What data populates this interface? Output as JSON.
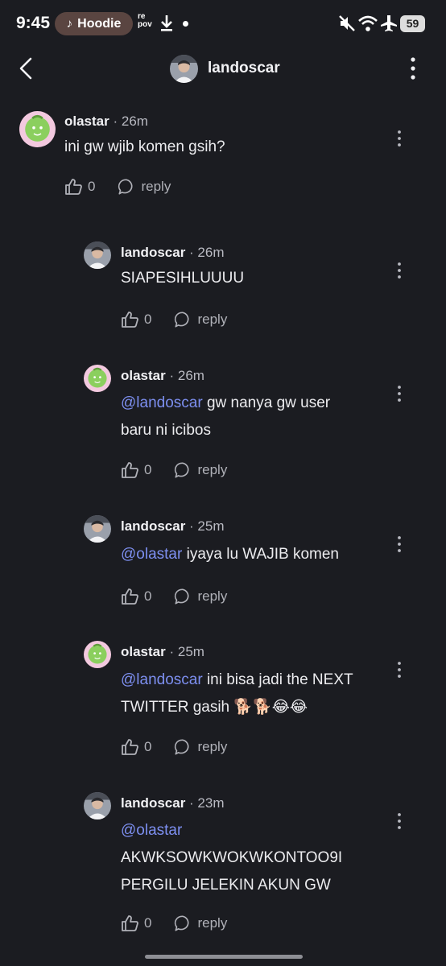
{
  "status_bar": {
    "time": "9:45",
    "music_label": "Hoodie",
    "app_tag_line1": "re",
    "app_tag_line2": "pov",
    "battery": "59",
    "icons": [
      "music-note-icon",
      "download-icon",
      "mute-icon",
      "wifi-icon",
      "airplane-icon",
      "battery-icon"
    ]
  },
  "header": {
    "title": "landoscar",
    "icons": [
      "back-icon",
      "more-vert-icon"
    ]
  },
  "colors": {
    "background": "#1b1c21",
    "mention": "#7d8ff0",
    "meta_text": "#b9bac2"
  },
  "comments": [
    {
      "author": "olastar",
      "time": "· 26m",
      "mention": "",
      "text": "ini gw wjib komen gsih?",
      "likes": "0",
      "reply_label": "reply"
    },
    {
      "author": "landoscar",
      "time": "· 26m",
      "mention": "",
      "text": "SIAPESIHLUUUU",
      "likes": "0",
      "reply_label": "reply"
    },
    {
      "author": "olastar",
      "time": "· 26m",
      "mention": "@landoscar",
      "text": " gw nanya gw user baru ni icibos",
      "likes": "0",
      "reply_label": "reply"
    },
    {
      "author": "landoscar",
      "time": "· 25m",
      "mention": "@olastar",
      "text": " iyaya lu WAJIB komen",
      "likes": "0",
      "reply_label": "reply"
    },
    {
      "author": "olastar",
      "time": "· 25m",
      "mention": "@landoscar",
      "text": " ini bisa jadi the NEXT TWITTER gasih 🐕🐕😂😂",
      "likes": "0",
      "reply_label": "reply"
    },
    {
      "author": "landoscar",
      "time": "· 23m",
      "mention": "@olastar",
      "text": " AKWKSOWKWOKWKONTOO9I PERGILU JELEKIN AKUN GW",
      "likes": "0",
      "reply_label": "reply"
    }
  ]
}
